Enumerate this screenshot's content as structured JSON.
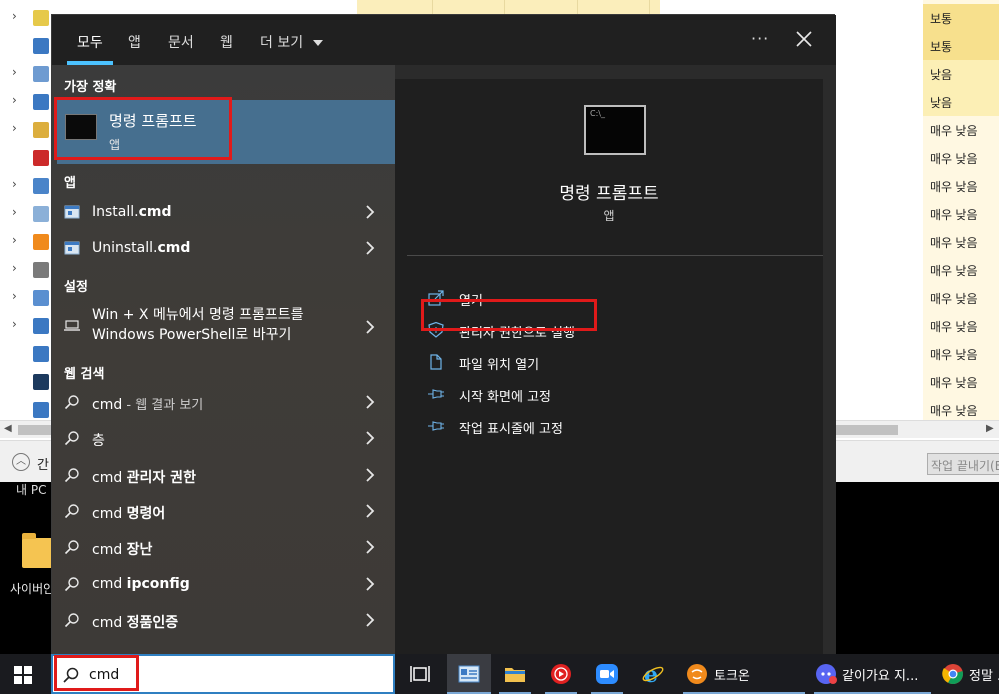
{
  "background": {
    "impact_values": [
      "보통",
      "보통",
      "낮음",
      "낮음",
      "매우 낮음",
      "매우 낮음",
      "매우 낮음",
      "매우 낮음",
      "매우 낮음",
      "매우 낮음",
      "매우 낮음",
      "매우 낮음",
      "매우 낮음",
      "매우 낮음",
      "매우 낮음"
    ],
    "collapse_label": "간",
    "end_task_label": "작업 끝내기(E)",
    "desktop_label_top": "내 PC",
    "desktop_icon_label": "사이버안"
  },
  "tabs": [
    {
      "label": "모두"
    },
    {
      "label": "앱"
    },
    {
      "label": "문서"
    },
    {
      "label": "웹"
    },
    {
      "label": "더 보기"
    }
  ],
  "header": {
    "more_label": "···"
  },
  "sections": {
    "best_match": "가장 정확",
    "apps": "앱",
    "settings": "설정",
    "web": "웹 검색"
  },
  "best_match": {
    "name": "명령 프롬프트",
    "type": "앱"
  },
  "apps": [
    {
      "prefix": "Install.",
      "bold": "cmd"
    },
    {
      "prefix": "Uninstall.",
      "bold": "cmd"
    }
  ],
  "settings": [
    {
      "line1": "Win + X 메뉴에서 명령 프롬프트를",
      "line2": "Windows PowerShell로 바꾸기"
    }
  ],
  "web_results": [
    {
      "prefix": "cmd",
      "bold": "",
      "sub": " - 웹 결과 보기"
    },
    {
      "prefix": "",
      "bold": "",
      "sub": "",
      "plain": "층"
    },
    {
      "prefix": "cmd ",
      "bold": "관리자 권한",
      "sub": ""
    },
    {
      "prefix": "cmd ",
      "bold": "명령어",
      "sub": ""
    },
    {
      "prefix": "cmd ",
      "bold": "장난",
      "sub": ""
    },
    {
      "prefix": "cmd ",
      "bold": "ipconfig",
      "sub": ""
    },
    {
      "prefix": "cmd ",
      "bold": "정품인증",
      "sub": ""
    }
  ],
  "detail": {
    "name": "명령 프롬프트",
    "type": "앱",
    "actions": [
      {
        "label": "열기",
        "icon": "open-icon"
      },
      {
        "label": "관리자 권한으로 실행",
        "icon": "shield-icon"
      },
      {
        "label": "파일 위치 열기",
        "icon": "file-location-icon"
      },
      {
        "label": "시작 화면에 고정",
        "icon": "pin-icon"
      },
      {
        "label": "작업 표시줄에 고정",
        "icon": "pin-icon"
      }
    ]
  },
  "search": {
    "value": "cmd"
  },
  "taskbar": {
    "talkon_label": "토크온",
    "together_label": "같이가요 지...",
    "chrome_label": "정말 ..."
  },
  "colors": {
    "accent": "#4cc2ff",
    "best_match_bg": "#466f8f",
    "highlight_red": "#e01a1a"
  }
}
